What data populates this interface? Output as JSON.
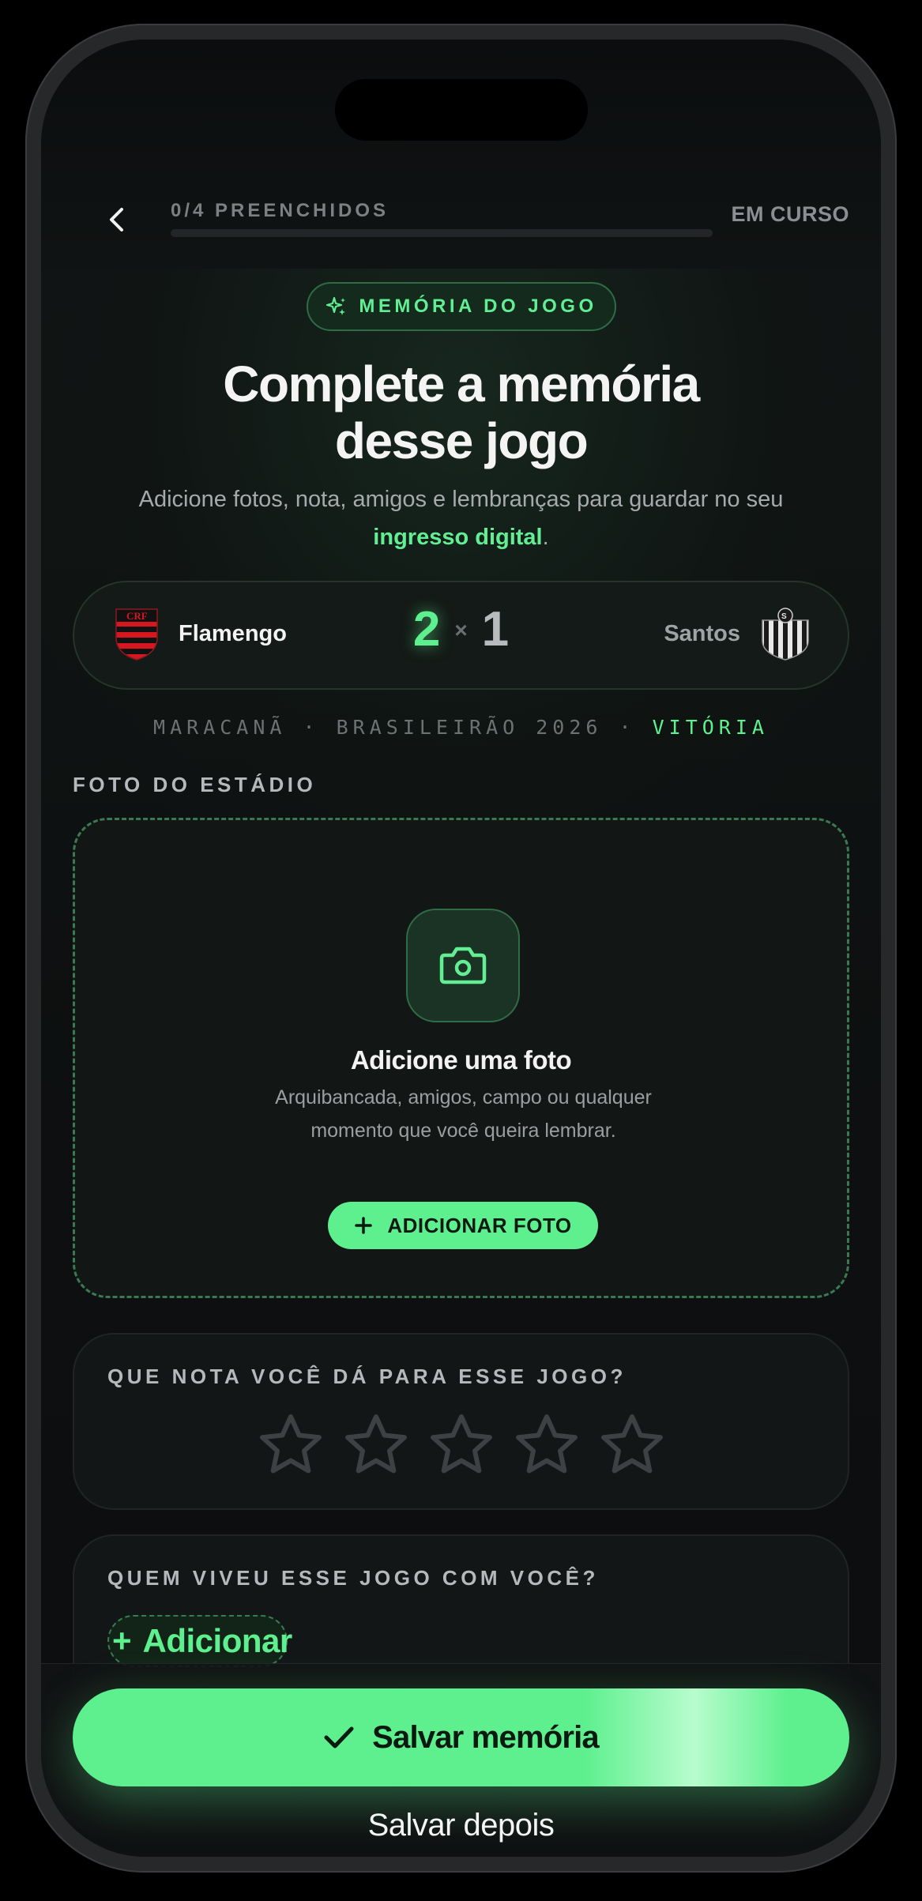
{
  "header": {
    "back_icon": "chevron-left-icon",
    "progress_label": "0/4 PREENCHIDOS",
    "progress_fraction": 0,
    "status": "EM CURSO"
  },
  "badge": {
    "icon": "sparkle-icon",
    "label": "MEMÓRIA DO JOGO"
  },
  "title": {
    "line1": "Complete a memória",
    "line2": "desse jogo"
  },
  "subtitle": {
    "text_before": "Adicione fotos, nota, amigos e lembranças para guardar no seu ",
    "highlight": "ingresso digital",
    "text_after": "."
  },
  "match": {
    "home": {
      "name": "Flamengo",
      "crest_icon": "flamengo-crest-icon"
    },
    "away": {
      "name": "Santos",
      "crest_icon": "santos-crest-icon"
    },
    "home_score": "2",
    "separator": "×",
    "away_score": "1",
    "meta_prefix": "MARACANÃ · BRASILEIRÃO 2026 · ",
    "result": "VITÓRIA"
  },
  "photo": {
    "section_label": "FOTO DO ESTÁDIO",
    "icon": "camera-icon",
    "title": "Adicione uma foto",
    "description": "Arquibancada, amigos, campo ou qualquer momento que você queira lembrar.",
    "button_label": "ADICIONAR FOTO"
  },
  "rating": {
    "label": "QUE NOTA VOCÊ DÁ PARA ESSE JOGO?",
    "max_stars": 5,
    "value": 0
  },
  "friends": {
    "label": "QUEM VIVEU ESSE JOGO COM VOCÊ?",
    "add_label": "Adicionar"
  },
  "footer": {
    "save_label": "Salvar memória",
    "later_label": "Salvar depois"
  },
  "colors": {
    "accent": "#5ef08f",
    "background": "#0e1011",
    "card_border": "#202425"
  }
}
